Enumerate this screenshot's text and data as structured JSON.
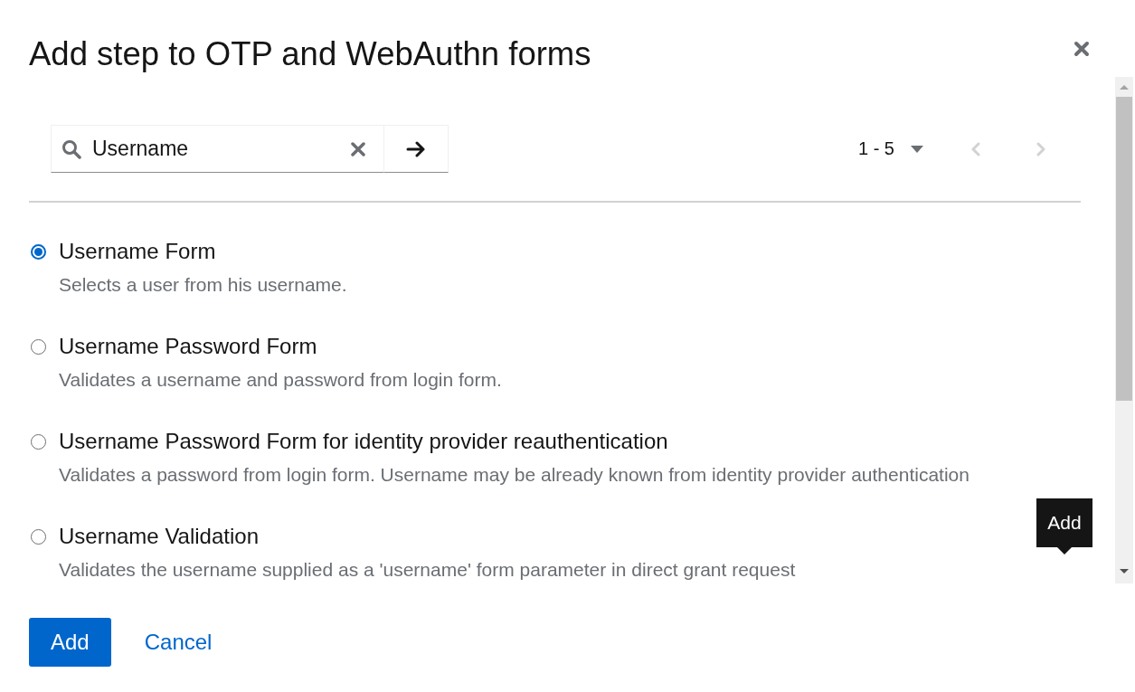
{
  "dialog": {
    "title": "Add step to OTP and WebAuthn forms"
  },
  "search": {
    "value": "Username"
  },
  "pagination": {
    "range": "1 - 5",
    "previous_disabled": true,
    "next_disabled": true
  },
  "options": [
    {
      "label": "Username Form",
      "description": "Selects a user from his username.",
      "selected": true
    },
    {
      "label": "Username Password Form",
      "description": "Validates a username and password from login form.",
      "selected": false
    },
    {
      "label": "Username Password Form for identity provider reauthentication",
      "description": "Validates a password from login form. Username may be already known from identity provider authentication",
      "selected": false
    },
    {
      "label": "Username Validation",
      "description": "Validates the username supplied as a 'username' form parameter in direct grant request",
      "selected": false
    }
  ],
  "tooltip": {
    "text": "Add"
  },
  "footer": {
    "buttons": [
      {
        "label": "Add",
        "kind": "primary"
      },
      {
        "label": "Cancel",
        "kind": "link"
      }
    ]
  }
}
